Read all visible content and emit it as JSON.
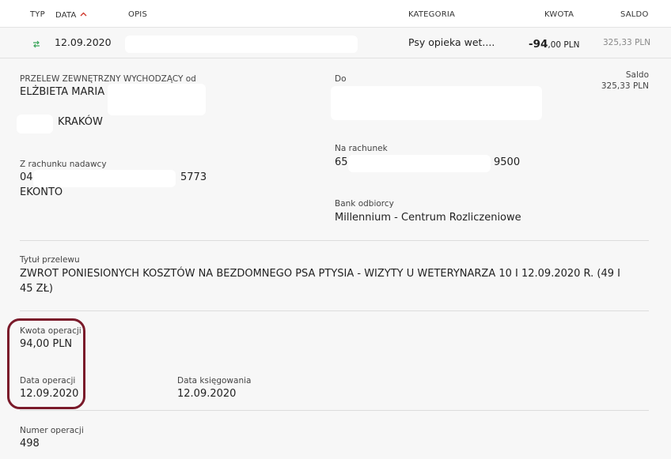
{
  "header": {
    "typ": "TYP",
    "data": "DATA",
    "opis": "OPIS",
    "kategoria": "KATEGORIA",
    "kwota": "KWOTA",
    "saldo": "SALDO"
  },
  "transaction": {
    "type_icon": "transfer-arrows-icon",
    "date": "12.09.2020",
    "category": "Psy opieka wet....",
    "amount_main": "-94",
    "amount_fraction": ",00 PLN",
    "balance": "325,33 PLN"
  },
  "details": {
    "type_label": "PRZELEW ZEWNĘTRZNY WYCHODZĄCY od",
    "sender_name": "ELŻBIETA MARIA",
    "sender_city": "KRAKÓW",
    "to_label": "Do",
    "saldo_label": "Saldo",
    "saldo_value": "325,33 PLN",
    "from_account_label": "Z rachunku nadawcy",
    "from_account_prefix": "04",
    "from_account_suffix": "5773",
    "from_account_name": "EKONTO",
    "to_account_label": "Na rachunek",
    "to_account_prefix": "65",
    "to_account_suffix": "9500",
    "bank_label": "Bank odbiorcy",
    "bank_value": "Millennium - Centrum Rozliczeniowe",
    "title_label": "Tytuł przelewu",
    "title_line1": "ZWROT PONIESIONYCH KOSZTÓW NA BEZDOMNEGO PSA PTYSIA - WIZYTY U WETERYNARZA 10 I 12.09.2020 R. (49 I",
    "title_line2": "45 ZŁ)",
    "amount_label": "Kwota operacji",
    "amount_value": "94,00 PLN",
    "op_date_label": "Data operacji",
    "op_date_value": "12.09.2020",
    "book_date_label": "Data księgowania",
    "book_date_value": "12.09.2020",
    "op_number_label": "Numer operacji",
    "op_number_value": "498"
  },
  "colors": {
    "accent_red": "#d0392e",
    "transfer_green": "#3aa55a",
    "highlight_border": "#7a1a2a"
  }
}
